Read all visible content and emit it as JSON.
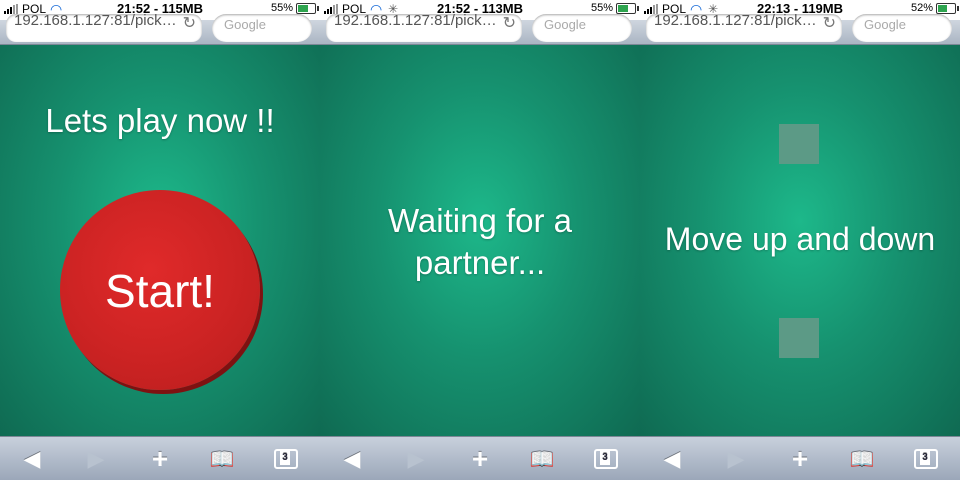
{
  "colors": {
    "stage_green": "#16916f",
    "button_red": "#d32626",
    "square": "#5c9a86"
  },
  "screens": [
    {
      "status": {
        "carrier": "POL",
        "time_mem": "21:52 - 115MB",
        "battery": "55%",
        "battery_level": 0.55
      },
      "url": "192.168.1.127:81/pick…",
      "search_placeholder": "Google",
      "heading": "Lets play now !!",
      "button_label": "Start!",
      "tab_count": "3"
    },
    {
      "status": {
        "carrier": "POL",
        "time_mem": "21:52 - 113MB",
        "battery": "55%",
        "battery_level": 0.55
      },
      "url": "192.168.1.127:81/pick…",
      "search_placeholder": "Google",
      "message_line1": "Waiting for a",
      "message_line2": "partner...",
      "tab_count": "3"
    },
    {
      "status": {
        "carrier": "POL",
        "time_mem": "22:13 - 119MB",
        "battery": "52%",
        "battery_level": 0.52
      },
      "url": "192.168.1.127:81/pick…",
      "search_placeholder": "Google",
      "instruction": "Move up and down",
      "tab_count": "3"
    }
  ],
  "toolbar_icons": [
    "back-icon",
    "forward-icon",
    "plus-icon",
    "bookmarks-icon",
    "tabs-icon"
  ]
}
